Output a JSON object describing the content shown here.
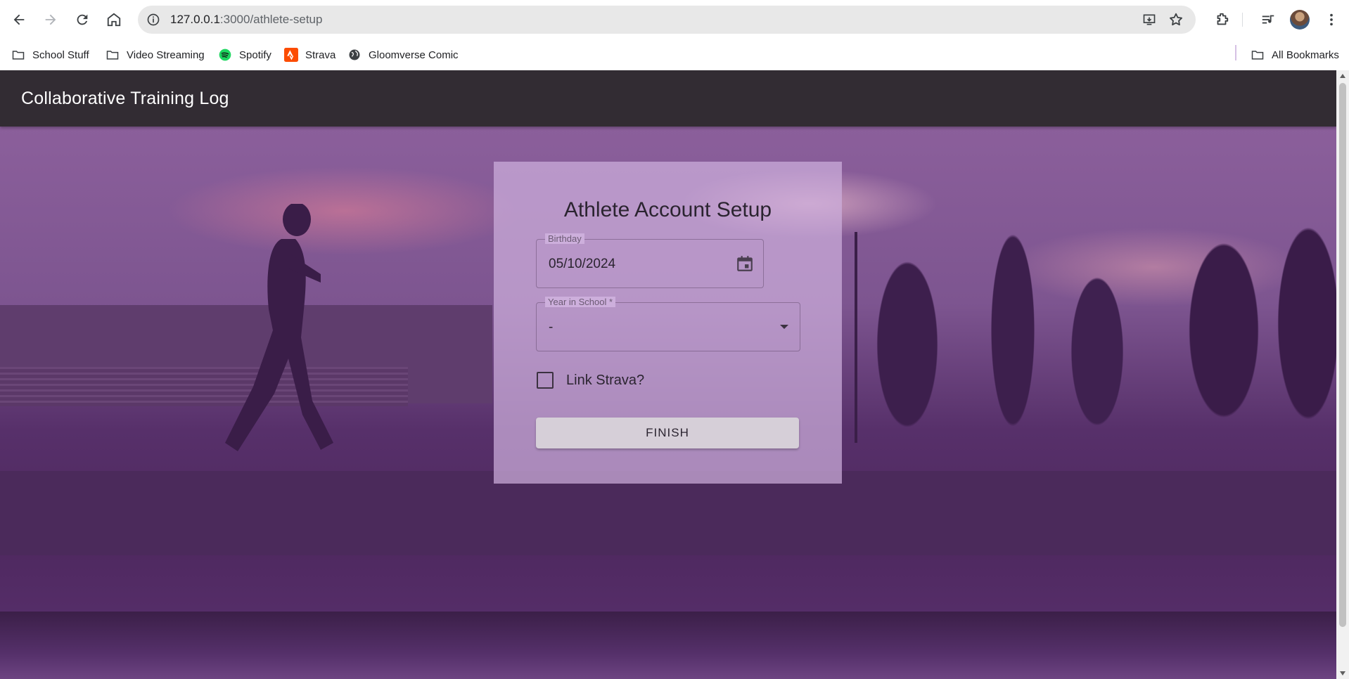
{
  "browser": {
    "url_host": "127.0.0.1",
    "url_path": ":3000/athlete-setup",
    "bookmarks": [
      {
        "label": "School Stuff",
        "icon": "folder-icon"
      },
      {
        "label": "Video Streaming",
        "icon": "folder-icon"
      },
      {
        "label": "Spotify",
        "icon": "spotify-icon"
      },
      {
        "label": "Strava",
        "icon": "strava-icon"
      },
      {
        "label": "Gloomverse Comic",
        "icon": "globe-icon"
      }
    ],
    "all_bookmarks_label": "All Bookmarks"
  },
  "app": {
    "title": "Collaborative Training Log"
  },
  "form": {
    "heading": "Athlete Account Setup",
    "birthday_label": "Birthday",
    "birthday_value": "05/10/2024",
    "year_label": "Year in School *",
    "year_value": "-",
    "strava_label": "Link Strava?",
    "strava_checked": false,
    "finish_label": "FINISH"
  },
  "colors": {
    "appbar": "#322c33",
    "card": "#cdafdc",
    "accent_purple": "#7d5590"
  }
}
